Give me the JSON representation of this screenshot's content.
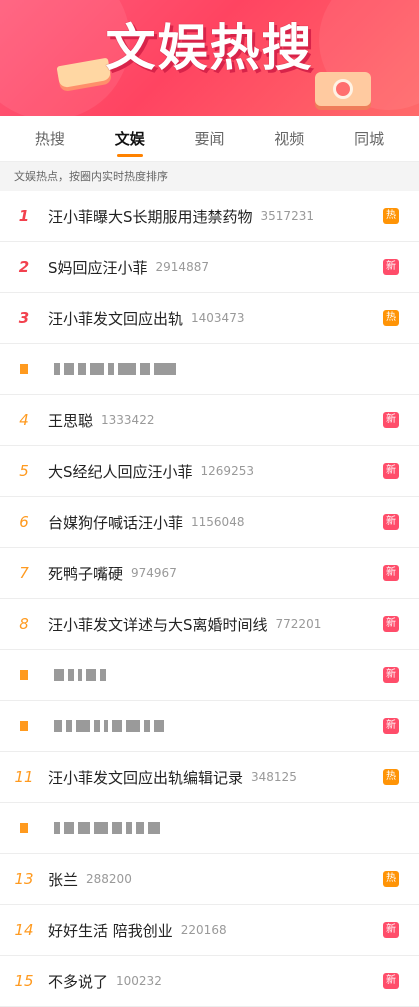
{
  "banner": {
    "title": "文娱热搜"
  },
  "tabs": [
    {
      "label": "热搜"
    },
    {
      "label": "文娱",
      "active": true
    },
    {
      "label": "要闻"
    },
    {
      "label": "视频"
    },
    {
      "label": "同城"
    }
  ],
  "subtitle": "文娱热点，按圈内实时热度排序",
  "rows": [
    {
      "rank": "1",
      "topic": "汪小菲曝大S长期服用违禁药物",
      "count": "3517231",
      "badge": "热",
      "badge_type": "hot"
    },
    {
      "rank": "2",
      "topic": "S妈回应汪小菲",
      "count": "2914887",
      "badge": "新",
      "badge_type": "new"
    },
    {
      "rank": "3",
      "topic": "汪小菲发文回应出轨",
      "count": "1403473",
      "badge": "热",
      "badge_type": "hot"
    },
    {
      "rank": "",
      "topic": "",
      "count": "",
      "badge": "",
      "badge_type": "",
      "redacted": true
    },
    {
      "rank": "4",
      "topic": "王思聪",
      "count": "1333422",
      "badge": "新",
      "badge_type": "new"
    },
    {
      "rank": "5",
      "topic": "大S经纪人回应汪小菲",
      "count": "1269253",
      "badge": "新",
      "badge_type": "new"
    },
    {
      "rank": "6",
      "topic": "台媒狗仔喊话汪小菲",
      "count": "1156048",
      "badge": "新",
      "badge_type": "new"
    },
    {
      "rank": "7",
      "topic": "死鸭子嘴硬",
      "count": "974967",
      "badge": "新",
      "badge_type": "new"
    },
    {
      "rank": "8",
      "topic": "汪小菲发文详述与大S离婚时间线",
      "count": "772201",
      "badge": "新",
      "badge_type": "new"
    },
    {
      "rank": "",
      "topic": "",
      "count": "",
      "badge": "新",
      "badge_type": "new",
      "redacted": true
    },
    {
      "rank": "",
      "topic": "",
      "count": "",
      "badge": "新",
      "badge_type": "new",
      "redacted": true
    },
    {
      "rank": "11",
      "topic": "汪小菲发文回应出轨编辑记录",
      "count": "348125",
      "badge": "热",
      "badge_type": "hot"
    },
    {
      "rank": "",
      "topic": "",
      "count": "",
      "badge": "",
      "badge_type": "",
      "redacted": true
    },
    {
      "rank": "13",
      "topic": "张兰",
      "count": "288200",
      "badge": "热",
      "badge_type": "hot"
    },
    {
      "rank": "14",
      "topic": "好好生活 陪我创业",
      "count": "220168",
      "badge": "新",
      "badge_type": "new"
    },
    {
      "rank": "15",
      "topic": "不多说了",
      "count": "100232",
      "badge": "新",
      "badge_type": "new"
    }
  ]
}
